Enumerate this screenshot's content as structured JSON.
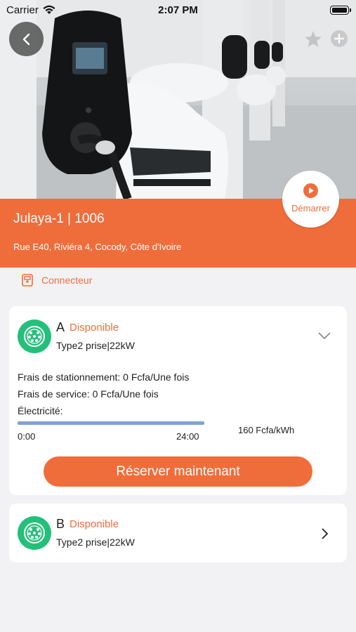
{
  "status_bar": {
    "carrier": "Carrier",
    "time": "2:07 PM"
  },
  "header": {
    "back_icon": "chevron-left-icon",
    "favorite_icon": "star-icon",
    "add_icon": "plus-icon"
  },
  "station": {
    "name": "Julaya-1 | 1006",
    "address": "Rue E40, Riviéra 4, Cocody, Côte d'Ivoire",
    "start_label": "Démarrer"
  },
  "section": {
    "label": "Connecteur",
    "icon": "charger-icon"
  },
  "connectors": [
    {
      "letter": "A",
      "status": "Disponible",
      "type": "Type2 prise|22kW",
      "expanded": true,
      "parking_fee": "Frais de stationnement: 0 Fcfa/Une fois",
      "service_fee": "Frais de service: 0 Fcfa/Une fois",
      "electricity_label": "Électricité:",
      "time_start": "0:00",
      "time_end": "24:00",
      "price": "160 Fcfa/kWh",
      "coverage_fraction": 1.0,
      "reserve_label": "Réserver maintenant"
    },
    {
      "letter": "B",
      "status": "Disponible",
      "type": "Type2 prise|22kW",
      "expanded": false
    }
  ],
  "colors": {
    "accent": "#ef6d3a",
    "connector_icon": "#23c07a",
    "progress": "#7ea3d8",
    "background": "#f2f2f4"
  }
}
